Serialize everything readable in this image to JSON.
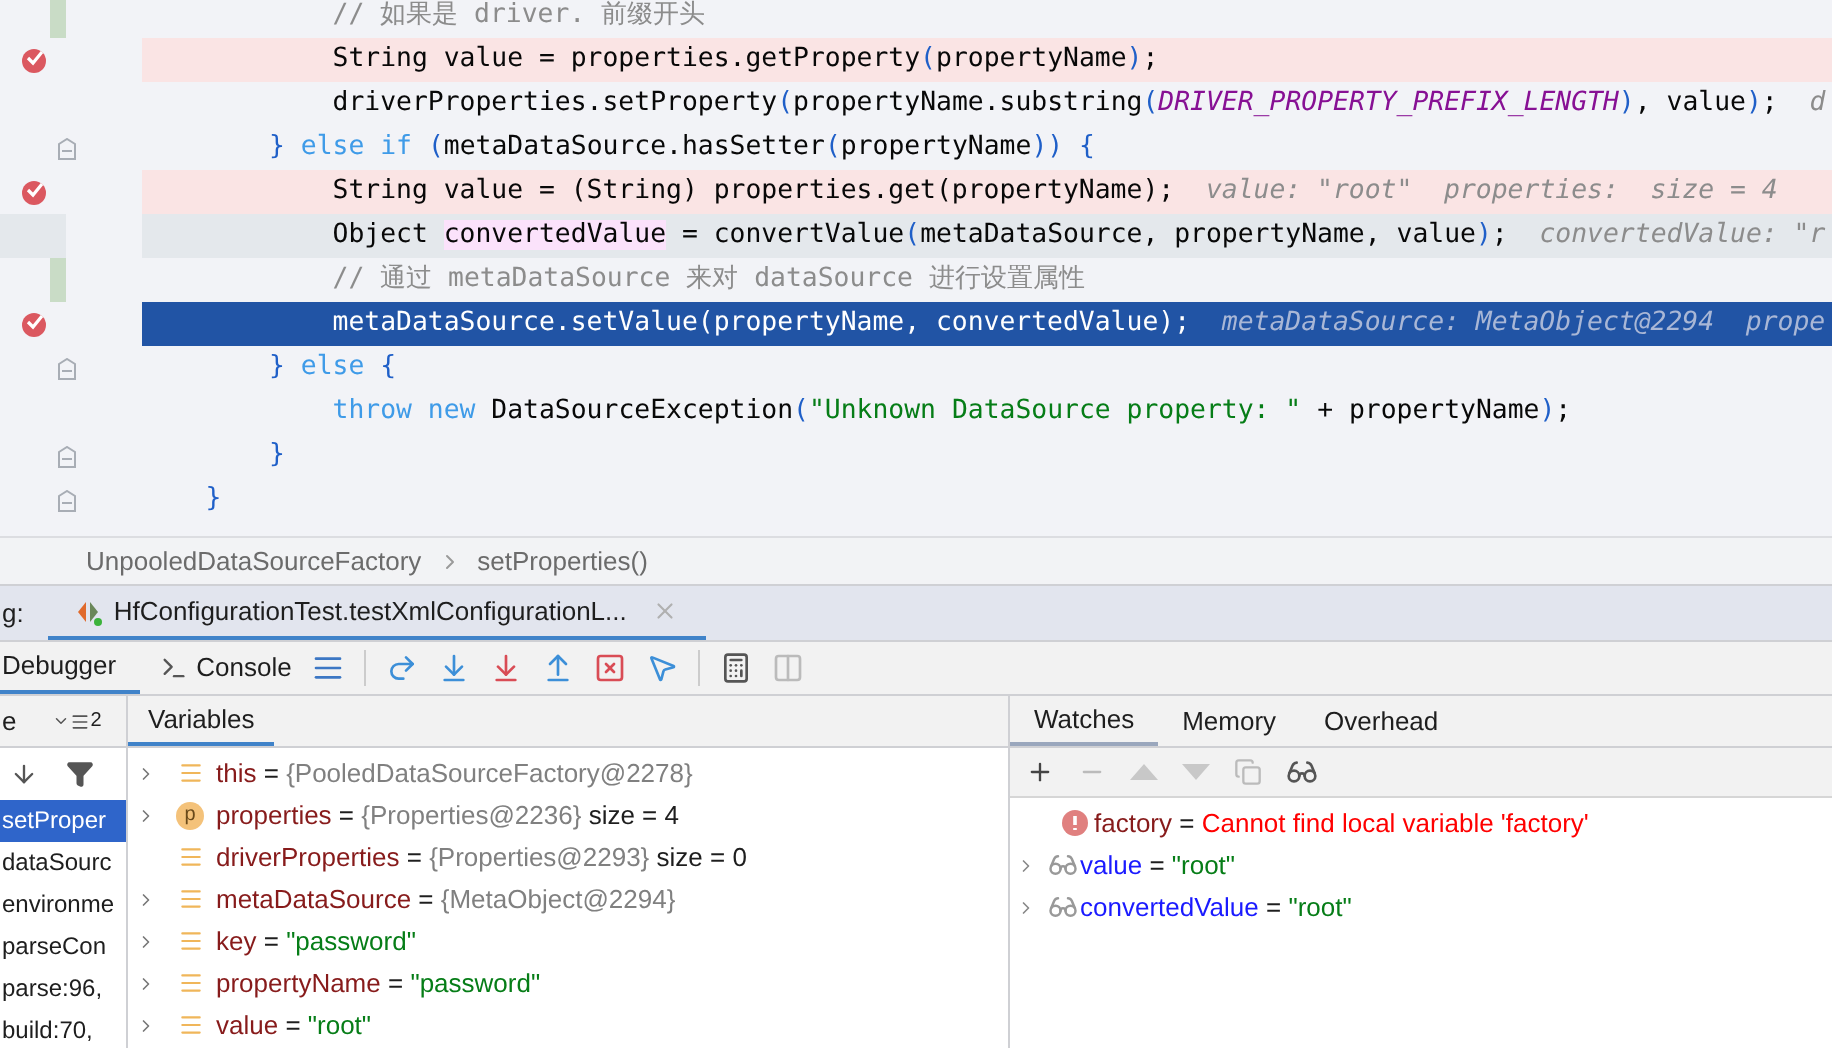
{
  "editor": {
    "lines": [
      {
        "kind": "plain",
        "breakpoint": false,
        "changed": true,
        "fold": false,
        "segments": [
          {
            "kind": "comment",
            "text": "            // 如果是 driver. 前缀开头"
          }
        ]
      },
      {
        "kind": "breakpoint",
        "breakpoint": true,
        "changed": false,
        "fold": false,
        "segments": [
          {
            "kind": "plain",
            "text": "            String value = properties.getProperty"
          },
          {
            "kind": "brace",
            "text": "("
          },
          {
            "kind": "plain",
            "text": "propertyName"
          },
          {
            "kind": "brace",
            "text": ")"
          },
          {
            "kind": "plain",
            "text": ";"
          }
        ]
      },
      {
        "kind": "plain",
        "breakpoint": false,
        "changed": false,
        "fold": false,
        "segments": [
          {
            "kind": "plain",
            "text": "            driverProperties.setProperty"
          },
          {
            "kind": "brace",
            "text": "("
          },
          {
            "kind": "plain",
            "text": "propertyName.substring"
          },
          {
            "kind": "brace",
            "text": "("
          },
          {
            "kind": "const",
            "text": "DRIVER_PROPERTY_PREFIX_LENGTH"
          },
          {
            "kind": "brace",
            "text": ")"
          },
          {
            "kind": "plain",
            "text": ", value"
          },
          {
            "kind": "brace",
            "text": ")"
          },
          {
            "kind": "plain",
            "text": ";"
          },
          {
            "kind": "hint",
            "text": "  d"
          }
        ]
      },
      {
        "kind": "plain",
        "breakpoint": false,
        "changed": false,
        "fold": true,
        "segments": [
          {
            "kind": "brace",
            "text": "        }"
          },
          {
            "kind": "keyword",
            "text": " else if "
          },
          {
            "kind": "brace",
            "text": "("
          },
          {
            "kind": "plain",
            "text": "metaDataSource.hasSetter"
          },
          {
            "kind": "brace",
            "text": "("
          },
          {
            "kind": "plain",
            "text": "propertyName"
          },
          {
            "kind": "brace",
            "text": ")) {"
          }
        ]
      },
      {
        "kind": "breakpoint",
        "breakpoint": true,
        "changed": false,
        "fold": false,
        "segments": [
          {
            "kind": "plain",
            "text": "            String value = (String) properties.get(propertyName);"
          },
          {
            "kind": "hint",
            "text": "  value: \"root\"  properties:  size = 4"
          }
        ]
      },
      {
        "kind": "focus",
        "breakpoint": false,
        "changed": false,
        "fold": false,
        "segments": [
          {
            "kind": "plain",
            "text": "            Object "
          },
          {
            "kind": "marked",
            "text": "convertedValue"
          },
          {
            "kind": "plain",
            "text": " = convertValue"
          },
          {
            "kind": "brace",
            "text": "("
          },
          {
            "kind": "plain",
            "text": "metaDataSource, propertyName, value"
          },
          {
            "kind": "brace",
            "text": ")"
          },
          {
            "kind": "plain",
            "text": ";"
          },
          {
            "kind": "hint",
            "text": "  convertedValue: \"r"
          }
        ]
      },
      {
        "kind": "plain",
        "breakpoint": false,
        "changed": true,
        "fold": false,
        "segments": [
          {
            "kind": "comment",
            "text": "            // 通过 metaDataSource 来对 dataSource 进行设置属性"
          }
        ]
      },
      {
        "kind": "execution",
        "breakpoint": true,
        "changed": false,
        "fold": false,
        "segments": [
          {
            "kind": "plain",
            "text": "            metaDataSource.setValue(propertyName, convertedValue);"
          },
          {
            "kind": "hint",
            "text": "  metaDataSource: MetaObject@2294  prope"
          }
        ]
      },
      {
        "kind": "plain",
        "breakpoint": false,
        "changed": false,
        "fold": true,
        "segments": [
          {
            "kind": "brace",
            "text": "        }"
          },
          {
            "kind": "keyword",
            "text": " else "
          },
          {
            "kind": "brace",
            "text": "{"
          }
        ]
      },
      {
        "kind": "plain",
        "breakpoint": false,
        "changed": false,
        "fold": false,
        "segments": [
          {
            "kind": "keyword",
            "text": "            throw new "
          },
          {
            "kind": "plain",
            "text": "DataSourceException"
          },
          {
            "kind": "brace",
            "text": "("
          },
          {
            "kind": "string",
            "text": "\"Unknown DataSource property: \""
          },
          {
            "kind": "plain",
            "text": " + propertyName"
          },
          {
            "kind": "brace",
            "text": ")"
          },
          {
            "kind": "plain",
            "text": ";"
          }
        ]
      },
      {
        "kind": "plain",
        "breakpoint": false,
        "changed": false,
        "fold": true,
        "segments": [
          {
            "kind": "brace",
            "text": "        }"
          }
        ]
      },
      {
        "kind": "plain",
        "breakpoint": false,
        "changed": false,
        "fold": true,
        "segments": [
          {
            "kind": "brace",
            "text": "    }"
          }
        ]
      }
    ]
  },
  "breadcrumb": [
    "UnpooledDataSourceFactory",
    "setProperties()"
  ],
  "debug_bar": {
    "label": "g:",
    "session_tab": "HfConfigurationTest.testXmlConfigurationL..."
  },
  "toolbar": {
    "tabs": [
      {
        "label": "Debugger",
        "selected": true
      },
      {
        "label": "Console",
        "selected": false
      }
    ]
  },
  "frames": {
    "header": "e",
    "layout_count": "2",
    "items": [
      {
        "label": "setProper",
        "selected": true
      },
      {
        "label": "dataSourc",
        "selected": false
      },
      {
        "label": "environme",
        "selected": false
      },
      {
        "label": "parseCon",
        "selected": false
      },
      {
        "label": "parse:96,",
        "selected": false
      },
      {
        "label": "build:70,",
        "selected": false
      }
    ]
  },
  "variables": {
    "title": "Variables",
    "rows": [
      {
        "expandable": true,
        "kind": "field",
        "name": "this",
        "separator": "=",
        "value": {
          "kind": "object",
          "text": "{PooledDataSourceFactory@2278}"
        }
      },
      {
        "expandable": true,
        "kind": "param",
        "icon_text": "p",
        "name": "properties",
        "separator": "=",
        "value": {
          "kind": "object",
          "text": "{Properties@2236}"
        },
        "extra": "size = 4"
      },
      {
        "expandable": false,
        "kind": "field",
        "name": "driverProperties",
        "separator": "=",
        "value": {
          "kind": "object",
          "text": "{Properties@2293}"
        },
        "extra": "size = 0"
      },
      {
        "expandable": true,
        "kind": "field",
        "name": "metaDataSource",
        "separator": "=",
        "value": {
          "kind": "object",
          "text": "{MetaObject@2294}"
        }
      },
      {
        "expandable": true,
        "kind": "field",
        "name": "key",
        "separator": "=",
        "value": {
          "kind": "string",
          "text": "\"password\""
        }
      },
      {
        "expandable": true,
        "kind": "field",
        "name": "propertyName",
        "separator": "=",
        "value": {
          "kind": "string",
          "text": "\"password\""
        }
      },
      {
        "expandable": true,
        "kind": "field",
        "name": "value",
        "separator": "=",
        "value": {
          "kind": "string",
          "text": "\"root\""
        }
      }
    ]
  },
  "watches": {
    "tabs": [
      {
        "label": "Watches",
        "selected": true
      },
      {
        "label": "Memory",
        "selected": false
      },
      {
        "label": "Overhead",
        "selected": false
      }
    ],
    "items": [
      {
        "kind": "error",
        "expandable": false,
        "name": "factory",
        "separator": "=",
        "value": "Cannot find local variable 'factory'"
      },
      {
        "kind": "watch",
        "expandable": true,
        "name": "value",
        "separator": "=",
        "value": "\"root\""
      },
      {
        "kind": "watch",
        "expandable": true,
        "name": "convertedValue",
        "separator": "=",
        "value": "\"root\""
      }
    ]
  }
}
